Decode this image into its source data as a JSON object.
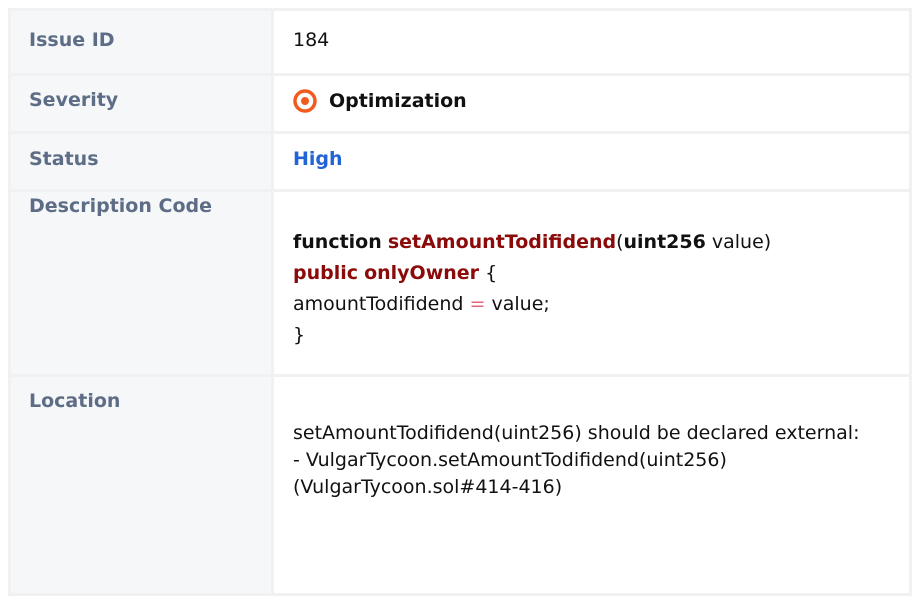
{
  "rows": {
    "issue_id": {
      "label": "Issue ID",
      "value": "184"
    },
    "severity": {
      "label": "Severity",
      "value": "Optimization",
      "icon": "target-icon",
      "icon_color": "#f35b1e"
    },
    "status": {
      "label": "Status",
      "value": "High",
      "color": "#2264d6"
    },
    "description": {
      "label": "Description Code",
      "code": {
        "kw_function": "function",
        "fn_name": "setAmountTodifidend",
        "paren_open": "(",
        "type": "uint256",
        "param": " value)",
        "kw_public": "public",
        "kw_modifier": "onlyOwner",
        "brace_open": " {",
        "var": "amountTodifidend",
        "op": "=",
        "rhs": " value;",
        "brace_close": "}"
      }
    },
    "location": {
      "label": "Location",
      "lines": [
        "setAmountTodifidend(uint256) should be declared external:",
        "- VulgarTycoon.setAmountTodifidend(uint256) (VulgarTycoon.sol#414-416)"
      ]
    }
  }
}
